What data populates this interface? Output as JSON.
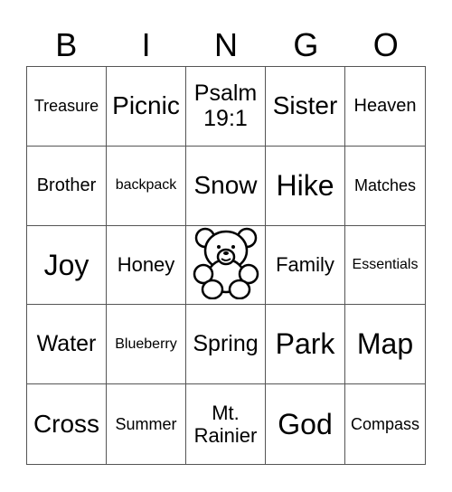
{
  "header": [
    "B",
    "I",
    "N",
    "G",
    "O"
  ],
  "cells": [
    {
      "text": "Treasure",
      "size": "s18"
    },
    {
      "text": "Picnic",
      "size": "s28"
    },
    {
      "text": "Psalm 19:1",
      "size": "s25"
    },
    {
      "text": "Sister",
      "size": "s28"
    },
    {
      "text": "Heaven",
      "size": "s20"
    },
    {
      "text": "Brother",
      "size": "s20"
    },
    {
      "text": "backpack",
      "size": "s16"
    },
    {
      "text": "Snow",
      "size": "s28"
    },
    {
      "text": "Hike",
      "size": "s32"
    },
    {
      "text": "Matches",
      "size": "s18"
    },
    {
      "text": "Joy",
      "size": "s32"
    },
    {
      "text": "Honey",
      "size": "s22"
    },
    {
      "text": "",
      "icon": "teddy-bear-icon",
      "free": true
    },
    {
      "text": "Family",
      "size": "s22"
    },
    {
      "text": "Essentials",
      "size": "s16"
    },
    {
      "text": "Water",
      "size": "s25"
    },
    {
      "text": "Blueberry",
      "size": "s16"
    },
    {
      "text": "Spring",
      "size": "s25"
    },
    {
      "text": "Park",
      "size": "s32"
    },
    {
      "text": "Map",
      "size": "s32"
    },
    {
      "text": "Cross",
      "size": "s28"
    },
    {
      "text": "Summer",
      "size": "s18"
    },
    {
      "text": "Mt. Rainier",
      "size": "s22"
    },
    {
      "text": "God",
      "size": "s32"
    },
    {
      "text": "Compass",
      "size": "s18"
    }
  ]
}
